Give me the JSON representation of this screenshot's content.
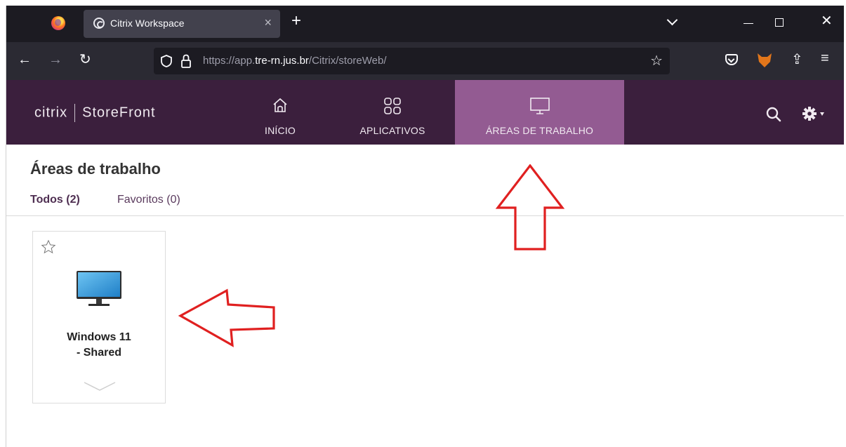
{
  "browser": {
    "tab_title": "Citrix Workspace",
    "url_prefix": "https://app.",
    "url_host": "tre-rn.jus.br",
    "url_path": "/Citrix/storeWeb/"
  },
  "storefront": {
    "brand_left": "citrix",
    "brand_right": "StoreFront",
    "nav": {
      "home": "INÍCIO",
      "apps": "APLICATIVOS",
      "desktops": "ÁREAS DE TRABALHO"
    },
    "accent_color": "#935b92",
    "header_color": "#3b1f3d"
  },
  "page": {
    "title": "Áreas de trabalho",
    "filter_all": "Todos (2)",
    "filter_favorites": "Favoritos (0)"
  },
  "desktop_card": {
    "name": "Windows 11 - Shared",
    "icon": "monitor-icon",
    "favorite_icon": "star-outline-icon"
  },
  "annotations": {
    "arrow_color": "#e02020"
  }
}
